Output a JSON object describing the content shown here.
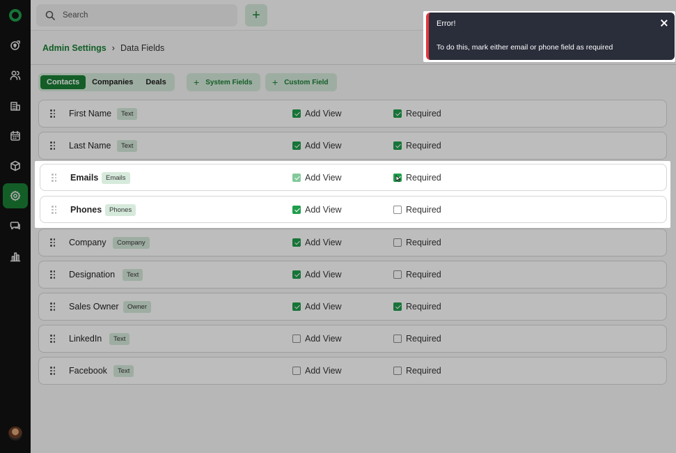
{
  "search": {
    "label": "Search"
  },
  "header": {
    "add_symbol": "+"
  },
  "breadcrumb": {
    "parent": "Admin Settings",
    "separator": "›",
    "current": "Data Fields"
  },
  "tabs": [
    {
      "label": "Contacts",
      "active": true
    },
    {
      "label": "Companies",
      "active": false
    },
    {
      "label": "Deals",
      "active": false
    }
  ],
  "actions": {
    "system_fields": "System Fields",
    "custom_field": "Custom Field",
    "plus": "+"
  },
  "rows": [
    {
      "name": "First Name",
      "badge": "Text",
      "add_view": true,
      "required": true
    },
    {
      "name": "Last Name",
      "badge": "Text",
      "add_view": true,
      "required": true
    },
    {
      "name": "Emails",
      "badge": "Emails",
      "add_view": true,
      "required": true
    },
    {
      "name": "Phones",
      "badge": "Phones",
      "add_view": true,
      "required": false
    },
    {
      "name": "Company",
      "badge": "Company",
      "add_view": true,
      "required": false
    },
    {
      "name": "Designation",
      "badge": "Text",
      "add_view": true,
      "required": false
    },
    {
      "name": "Sales Owner",
      "badge": "Owner",
      "add_view": true,
      "required": true
    },
    {
      "name": "LinkedIn",
      "badge": "Text",
      "add_view": false,
      "required": false
    },
    {
      "name": "Facebook",
      "badge": "Text",
      "add_view": false,
      "required": false
    }
  ],
  "labels": {
    "add_view": "Add View",
    "required": "Required"
  },
  "toast": {
    "title": "Error!",
    "message": "To do this, mark either email or phone field as required"
  },
  "icons": {
    "sidebar": [
      "logo-icon",
      "deals-icon",
      "contacts-icon",
      "companies-icon",
      "calendar-icon",
      "products-icon",
      "settings-icon",
      "chat-icon",
      "reports-icon"
    ],
    "accent": "#1a7f35",
    "error": "#e0393e"
  }
}
